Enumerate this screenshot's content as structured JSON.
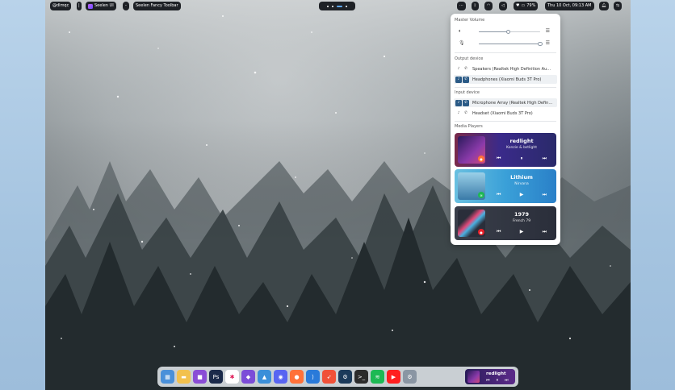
{
  "topbar": {
    "user": "@dlmqc",
    "separator": "|",
    "app_name": "Seelen UI",
    "arrow": "-",
    "toolbar_title": "Seelen Fancy Toolbar",
    "more_label": "···",
    "battery": "79%",
    "datetime": "Thu 10 Oct, 09:13 AM"
  },
  "panel": {
    "master_volume_title": "Master Volume",
    "output_title": "Output device",
    "input_title": "Input device",
    "media_title": "Media Players",
    "output_volume": 0.48,
    "input_volume": 1.0,
    "output_devices": [
      {
        "label": "Speakers (Realtek High Definition Audio)",
        "selected": false
      },
      {
        "label": "Headphones (Xiaomi Buds 3T Pro)",
        "selected": true
      }
    ],
    "input_devices": [
      {
        "label": "Microphone Array (Realtek High Definition Audio)",
        "selected": true
      },
      {
        "label": "Headset (Xiaomi Buds 3T Pro)",
        "selected": false
      }
    ],
    "players": [
      {
        "title": "redlight",
        "artist": "Konzie & bstlight",
        "source_icon": "firefox-icon",
        "play_state": "paused",
        "bg": "#4a2a9a"
      },
      {
        "title": "Lithium",
        "artist": "Nirvana",
        "source_icon": "spotify-icon",
        "play_state": "stopped",
        "bg": "#3ca8d8"
      },
      {
        "title": "1979",
        "artist": "French 79",
        "source_icon": "music-icon",
        "play_state": "stopped",
        "bg": "#2a2f3a"
      }
    ]
  },
  "dock": {
    "apps": [
      {
        "name": "start-menu-icon",
        "color": "#4a90d9",
        "glyph": "▦"
      },
      {
        "name": "file-explorer-icon",
        "color": "#f2c14e",
        "glyph": "▬"
      },
      {
        "name": "app-purple-icon",
        "color": "#8a4dd6",
        "glyph": "■"
      },
      {
        "name": "photoshop-icon",
        "color": "#1b2a4a",
        "glyph": "Ps"
      },
      {
        "name": "slack-icon",
        "color": "#ffffff",
        "glyph": "✱"
      },
      {
        "name": "obsidian-icon",
        "color": "#7c4dd8",
        "glyph": "◆"
      },
      {
        "name": "affinity-icon",
        "color": "#3b8fd9",
        "glyph": "▲"
      },
      {
        "name": "discord-icon",
        "color": "#5865f2",
        "glyph": "◉"
      },
      {
        "name": "firefox-icon",
        "color": "#ff7139",
        "glyph": "●"
      },
      {
        "name": "vscode-icon",
        "color": "#2a7ad9",
        "glyph": "⟩"
      },
      {
        "name": "swift-icon",
        "color": "#f05138",
        "glyph": "➶"
      },
      {
        "name": "steam-icon",
        "color": "#1b3a5a",
        "glyph": "⚙"
      },
      {
        "name": "terminal-icon",
        "color": "#2b2b2b",
        "glyph": ">_"
      },
      {
        "name": "spotify-icon",
        "color": "#1db954",
        "glyph": "≋"
      },
      {
        "name": "youtube-music-icon",
        "color": "#ff1f1f",
        "glyph": "▶"
      },
      {
        "name": "settings-icon",
        "color": "#8a96a3",
        "glyph": "⚙"
      }
    ],
    "media_title": "redlight"
  }
}
